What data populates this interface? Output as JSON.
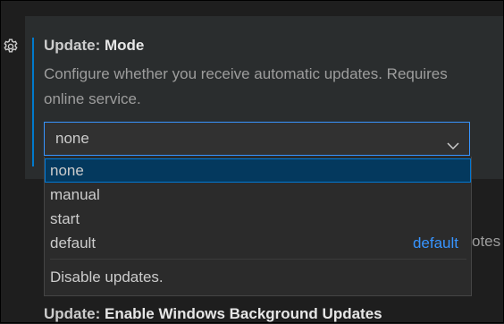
{
  "setting": {
    "category": "Update: ",
    "name": "Mode",
    "description_line1": "Configure whether you receive automatic updates. Requires",
    "description_line2": "online service.",
    "selected_value": "none"
  },
  "dropdown": {
    "options": [
      {
        "label": "none",
        "tag": ""
      },
      {
        "label": "manual",
        "tag": ""
      },
      {
        "label": "start",
        "tag": ""
      },
      {
        "label": "default",
        "tag": "default"
      }
    ],
    "selected_description": "Disable updates."
  },
  "partially_hidden_text": "otes",
  "next_setting": {
    "category": "Update: ",
    "name": "Enable Windows Background Updates"
  },
  "colors": {
    "background": "#1e1e1e",
    "card_background": "#2a2d2e",
    "focus_accent": "#007acc",
    "selected_option_bg": "#04395e",
    "link_blue": "#3794ff"
  },
  "icons": {
    "gear": "gear-icon",
    "chevron": "chevron-down-icon"
  }
}
